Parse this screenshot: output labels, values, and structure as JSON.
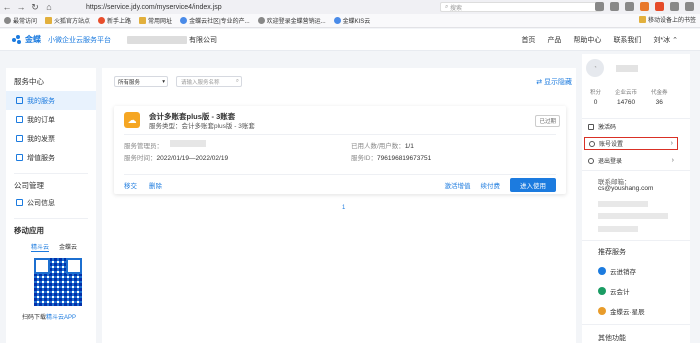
{
  "browser": {
    "url": "https://service.jdy.com/myservice4/index.jsp",
    "search_placeholder": "搜索",
    "bookmarks": [
      "最常访问",
      "火狐官方站点",
      "新手上路",
      "常用网址",
      "金蝶云社区|专业的产...",
      "欢迎登录金蝶营销运...",
      "金蝶KIS云"
    ],
    "mobile_bookmarks": "移动设备上的书签"
  },
  "header": {
    "brand": "金蝶",
    "subtitle": "小微企业云服务平台",
    "company": "有限公司",
    "nav": [
      "首页",
      "产品",
      "帮助中心",
      "联系我们"
    ],
    "user": "刘*冰"
  },
  "sidebar": {
    "service_center": "服务中心",
    "items": [
      "我的服务",
      "我的订单",
      "我的发票",
      "增值服务"
    ],
    "company_mgmt": "公司管理",
    "company_info": "公司信息",
    "mobile_app": "移动应用",
    "mobile_tabs": [
      "精斗云",
      "金蝶云"
    ],
    "qr_caption_prefix": "扫码下载",
    "qr_caption_link": "精斗云APP"
  },
  "main": {
    "filter_select": "所有服务",
    "search_placeholder": "请输入服务名称",
    "show_hidden": "显示隐藏",
    "card": {
      "title": "会计多账套plus版 - 3账套",
      "type_label": "服务类型：会计多账套plus版 - 3账套",
      "status": "已过期",
      "admin_label": "服务管理员：",
      "time_label": "服务时间：",
      "time_value": "2022/01/19—2022/02/19",
      "users_label": "已用人数/用户数：",
      "users_value": "1/1",
      "id_label": "服务ID：",
      "id_value": "796196819673751",
      "action_transfer": "移交",
      "action_delete": "删除",
      "action_activate": "激活增值",
      "action_renew": "续付费",
      "action_enter": "进入使用"
    },
    "page": "1"
  },
  "rpanel": {
    "stats": [
      {
        "label": "积分",
        "value": "0"
      },
      {
        "label": "企业云币",
        "value": "14760"
      },
      {
        "label": "代金券",
        "value": "36"
      }
    ],
    "menu": [
      "激活码",
      "账号设置",
      "退出登录"
    ],
    "contact_label": "联系邮箱：",
    "email": "cs@youshang.com",
    "recommend_title": "推荐服务",
    "recommend": [
      "云进销存",
      "云会计",
      "金蝶云·星辰"
    ],
    "other_title": "其他功能"
  }
}
